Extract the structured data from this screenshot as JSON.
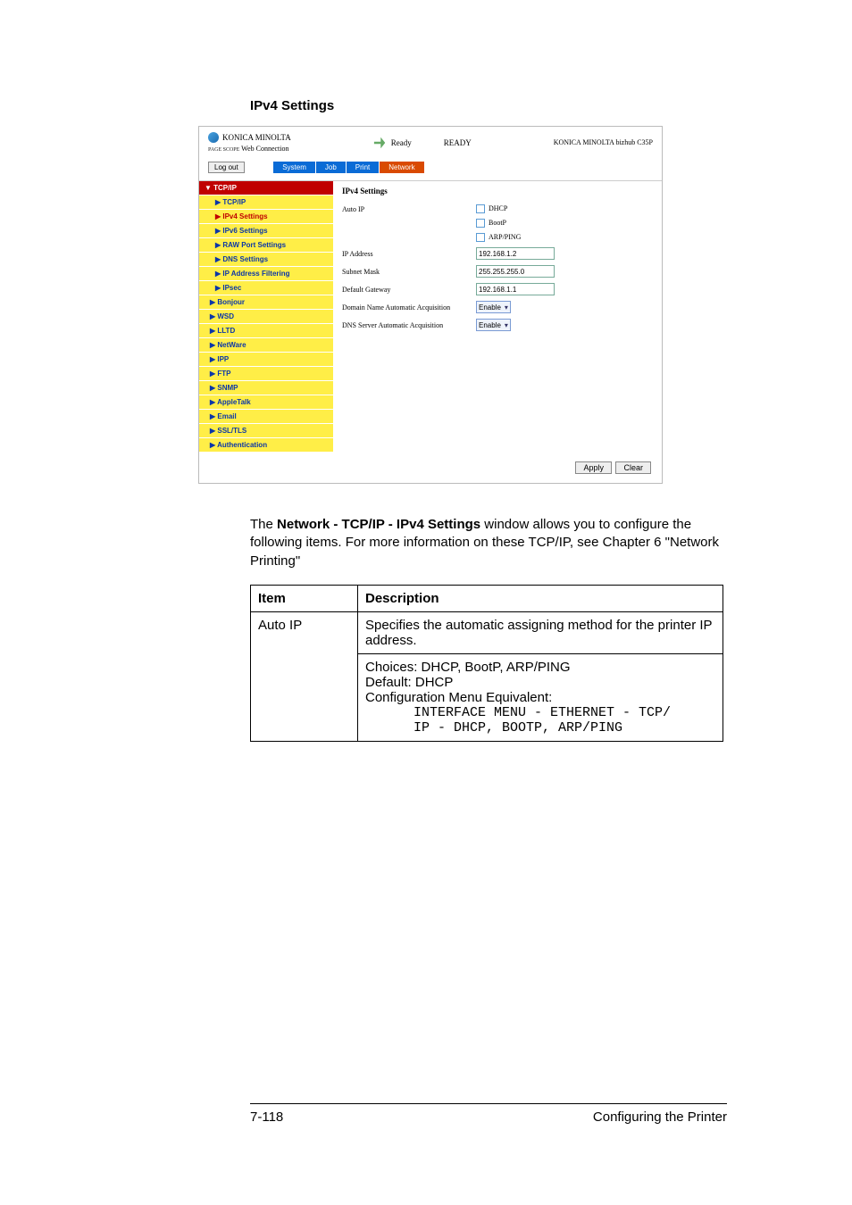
{
  "section_title": "IPv4 Settings",
  "screenshot": {
    "brand": "KONICA MINOLTA",
    "pagescope_prefix": "PAGE SCOPE",
    "pagescope": "Web Connection",
    "status_label": "Ready",
    "status_text": "READY",
    "model": "KONICA MINOLTA bizhub C35P",
    "logout": "Log out",
    "tabs": [
      "System",
      "Job",
      "Print",
      "Network"
    ],
    "nav_head": "▼ TCP/IP",
    "nav": [
      {
        "label": "▶ TCP/IP",
        "sub": true
      },
      {
        "label": "▶ IPv4 Settings",
        "sub": true,
        "active": true
      },
      {
        "label": "▶ IPv6 Settings",
        "sub": true
      },
      {
        "label": "▶ RAW Port Settings",
        "sub": true
      },
      {
        "label": "▶ DNS Settings",
        "sub": true
      },
      {
        "label": "▶ IP Address Filtering",
        "sub": true
      },
      {
        "label": "▶ IPsec",
        "sub": true
      },
      {
        "label": "▶ Bonjour"
      },
      {
        "label": "▶ WSD"
      },
      {
        "label": "▶ LLTD"
      },
      {
        "label": "▶ NetWare"
      },
      {
        "label": "▶ IPP"
      },
      {
        "label": "▶ FTP"
      },
      {
        "label": "▶ SNMP"
      },
      {
        "label": "▶ AppleTalk"
      },
      {
        "label": "▶ Email"
      },
      {
        "label": "▶ SSL/TLS"
      },
      {
        "label": "▶ Authentication"
      }
    ],
    "main_title": "IPv4 Settings",
    "auto_ip_label": "Auto IP",
    "chk1": "DHCP",
    "chk2": "BootP",
    "chk3": "ARP/PING",
    "ip_label": "IP Address",
    "ip_value": "192.168.1.2",
    "subnet_label": "Subnet Mask",
    "subnet_value": "255.255.255.0",
    "gateway_label": "Default Gateway",
    "gateway_value": "192.168.1.1",
    "domain_label": "Domain Name Automatic Acquisition",
    "domain_value": "Enable",
    "dns_label": "DNS Server Automatic Acquisition",
    "dns_value": "Enable",
    "apply": "Apply",
    "clear": "Clear"
  },
  "body_text_pre": "The ",
  "body_text_bold": "Network - TCP/IP - IPv4 Settings",
  "body_text_post": " window allows you to configure the following items. For more information on these TCP/IP, see Chapter 6 \"Network Printing\"",
  "table": {
    "h1": "Item",
    "h2": "Description",
    "r1c1": "Auto IP",
    "r1c2a": "Specifies the automatic assigning method for the printer IP address.",
    "r1c2b_l1": "Choices: DHCP, BootP, ARP/PING",
    "r1c2b_l2": "Default:  DHCP",
    "r1c2b_l3": "Configuration Menu Equivalent:",
    "r1c2b_mono": "      INTERFACE MENU - ETHERNET - TCP/\n      IP - DHCP, BOOTP, ARP/PING"
  },
  "footer": {
    "page": "7-118",
    "title": "Configuring the Printer"
  }
}
